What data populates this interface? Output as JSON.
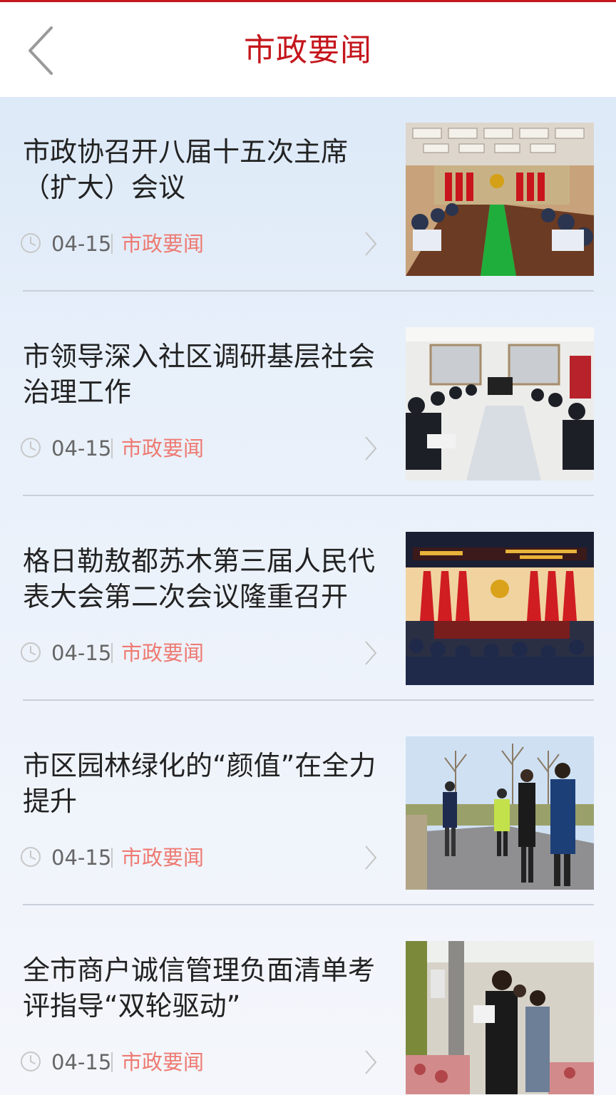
{
  "header": {
    "title": "市政要闻",
    "back_icon": "chevron-left-icon"
  },
  "colors": {
    "accent": "#c4161c",
    "category_text": "#ee7a72",
    "title_text": "#222222",
    "date_text": "#666666"
  },
  "news": [
    {
      "title": "市政协召开八届十五次主席（扩大）会议",
      "date": "04-15",
      "category": "市政要闻",
      "image": "meeting-room-photo"
    },
    {
      "title": "市领导深入社区调研基层社会治理工作",
      "date": "04-15",
      "category": "市政要闻",
      "image": "community-meeting-photo"
    },
    {
      "title": "格日勒敖都苏木第三届人民代表大会第二次会议隆重召开",
      "date": "04-15",
      "category": "市政要闻",
      "image": "congress-hall-photo"
    },
    {
      "title": "市区园林绿化的“颜值”在全力提升",
      "date": "04-15",
      "category": "市政要闻",
      "image": "street-inspection-photo"
    },
    {
      "title": "全市商户诚信管理负面清单考评指导“双轮驱动”",
      "date": "04-15",
      "category": "市政要闻",
      "image": "market-inspection-photo"
    }
  ]
}
